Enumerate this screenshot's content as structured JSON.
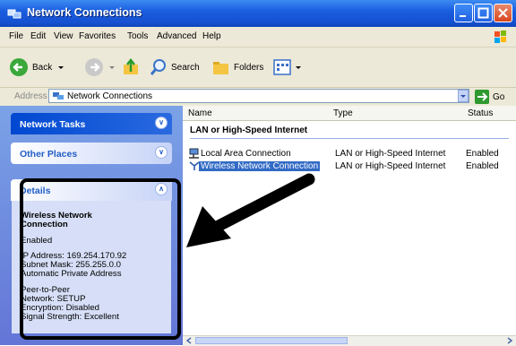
{
  "window": {
    "title": "Network Connections"
  },
  "menu": [
    "File",
    "Edit",
    "View",
    "Favorites",
    "Tools",
    "Advanced",
    "Help"
  ],
  "toolbar": {
    "back": "Back",
    "search": "Search",
    "folders": "Folders"
  },
  "address": {
    "label": "Address",
    "value": "Network Connections",
    "go": "Go"
  },
  "sidebar": {
    "network_tasks": "Network Tasks",
    "other_places": "Other Places",
    "details": {
      "title": "Details",
      "name_line1": "Wireless Network",
      "name_line2": "Connection",
      "status": "Enabled",
      "ip": "IP Address: 169.254.170.92",
      "subnet": "Subnet Mask: 255.255.0.0",
      "assign": "Automatic Private Address",
      "mode": "Peer-to-Peer",
      "network": "Network: SETUP",
      "encryption": "Encryption: Disabled",
      "signal": "Signal Strength: Excellent"
    }
  },
  "list": {
    "columns": {
      "name": "Name",
      "type": "Type",
      "status": "Status"
    },
    "group": "LAN or High-Speed Internet",
    "rows": [
      {
        "name": "Local Area Connection",
        "type": "LAN or High-Speed Internet",
        "status": "Enabled"
      },
      {
        "name": "Wireless Network Connection",
        "type": "LAN or High-Speed Internet",
        "status": "Enabled"
      }
    ]
  },
  "colors": {
    "titlebar": "#1a5ee0",
    "sidebar": "#6f8fdf",
    "selection": "#316ac5"
  }
}
